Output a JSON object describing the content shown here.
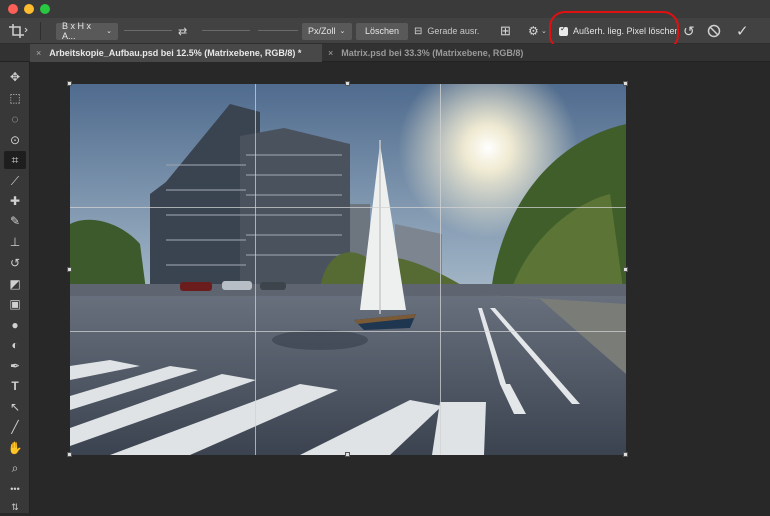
{
  "window": {
    "traffic_lights": [
      "#fe5f57",
      "#febc2e",
      "#28c840"
    ]
  },
  "options_bar": {
    "ratio_select": "B x H x A...",
    "unit_select": "Px/Zoll",
    "clear_button": "Löschen",
    "straighten_label": "Gerade ausr.",
    "delete_cropped_checkbox": {
      "label": "Außerh. lieg. Pixel löschen",
      "checked": true
    },
    "highlight_color": "#e01010"
  },
  "tabs": [
    {
      "label": "Arbeitskopie_Aufbau.psd bei 12.5% (Matrixebene, RGB/8) *",
      "active": true
    },
    {
      "label": "Matrix.psd bei 33.3% (Matrixebene, RGB/8)",
      "active": false
    }
  ],
  "tools": [
    "move-icon",
    "marquee-icon",
    "lasso-icon",
    "quick-select-icon",
    "crop-icon",
    "eyedropper-icon",
    "healing-icon",
    "brush-icon",
    "stamp-icon",
    "history-brush-icon",
    "eraser-icon",
    "gradient-icon",
    "blur-icon",
    "dodge-icon",
    "pen-icon",
    "type-icon",
    "path-select-icon",
    "line-icon",
    "hand-icon",
    "zoom-icon",
    "more-icon"
  ],
  "tool_glyphs": {
    "move": "✥",
    "marquee": "⬚",
    "lasso": "◌",
    "quick_select": "⊙",
    "crop": "⌗",
    "eyedropper": "⟋",
    "healing": "✚",
    "brush": "✎",
    "stamp": "⊥",
    "history_brush": "↺",
    "eraser": "◩",
    "gradient": "▣",
    "blur": "●",
    "dodge": "◐",
    "pen": "✒",
    "type": "T",
    "path_select": "↖",
    "line": "╱",
    "hand": "✋",
    "zoom": "⌕",
    "more": "•••"
  }
}
